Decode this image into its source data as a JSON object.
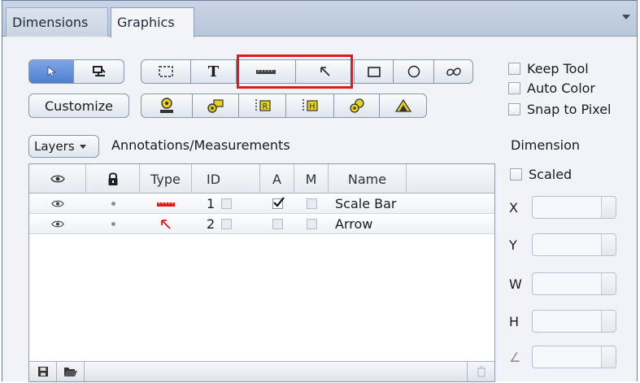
{
  "tabs": [
    {
      "label": "Dimensions"
    },
    {
      "label": "Graphics"
    }
  ],
  "toolbar": {
    "customize_label": "Customize",
    "text_tool_glyph": "T"
  },
  "options": {
    "keep_tool": "Keep Tool",
    "auto_color": "Auto Color",
    "snap_to_pixel": "Snap to Pixel"
  },
  "layers": {
    "button_label": "Layers",
    "section_title": "Annotations/Measurements"
  },
  "table": {
    "headers": {
      "type": "Type",
      "id": "ID",
      "a": "A",
      "m": "M",
      "name": "Name"
    },
    "rows": [
      {
        "id": "1",
        "name": "Scale Bar",
        "a_checked": true,
        "type_icon": "scale-bar-icon"
      },
      {
        "id": "2",
        "name": "Arrow",
        "a_checked": false,
        "type_icon": "arrow-icon"
      }
    ]
  },
  "dimension": {
    "title": "Dimension",
    "scaled_label": "Scaled",
    "fields": [
      {
        "label": "X"
      },
      {
        "label": "Y"
      },
      {
        "label": "W"
      },
      {
        "label": "H"
      },
      {
        "label": "∠"
      }
    ]
  },
  "colors": {
    "accent": "#4f7fcf",
    "highlight": "#e0191b",
    "annotation_red": "#e0191b"
  }
}
